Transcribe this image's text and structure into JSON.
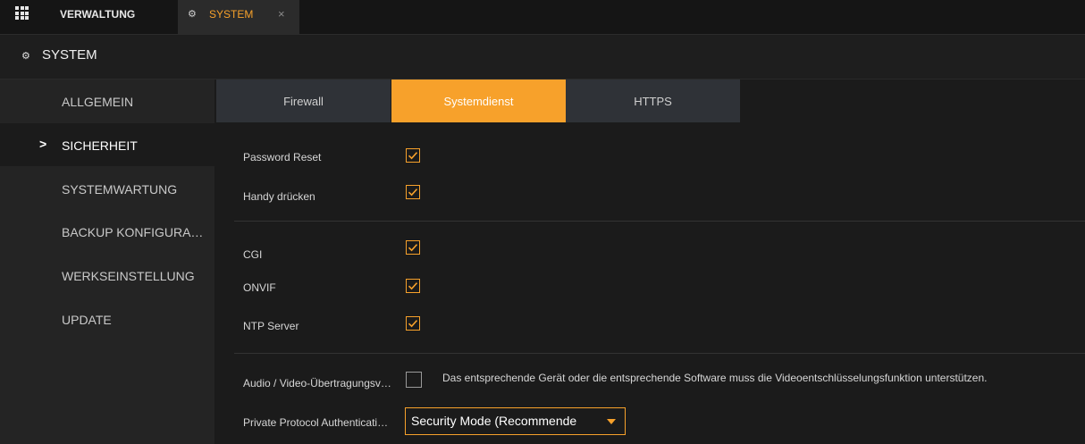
{
  "topbar": {
    "apps_icon": "grid-icon",
    "tab_main": "VERWALTUNG",
    "tab_system": "SYSTEM",
    "close_glyph": "×"
  },
  "header": {
    "title": "SYSTEM",
    "icon": "gear-icon"
  },
  "sidebar": {
    "items": [
      {
        "label": "ALLGEMEIN",
        "active": false
      },
      {
        "label": "SICHERHEIT",
        "active": true
      },
      {
        "label": "SYSTEMWARTUNG",
        "active": false
      },
      {
        "label": "BACKUP KONFIGURA…",
        "active": false
      },
      {
        "label": "WERKSEINSTELLUNG",
        "active": false
      },
      {
        "label": "UPDATE",
        "active": false
      }
    ]
  },
  "tabs": [
    {
      "label": "Firewall",
      "active": false
    },
    {
      "label": "Systemdienst",
      "active": true
    },
    {
      "label": "HTTPS",
      "active": false
    }
  ],
  "settings": {
    "password_reset": {
      "label": "Password Reset",
      "checked": true
    },
    "handy": {
      "label": "Handy drücken",
      "checked": true
    },
    "cgi": {
      "label": "CGI",
      "checked": true
    },
    "onvif": {
      "label": "ONVIF",
      "checked": true
    },
    "ntp": {
      "label": "NTP Server",
      "checked": true
    },
    "audio_video": {
      "label": "Audio / Video-Übertragungsv…",
      "checked": false,
      "note": "Das entsprechende Gerät oder die entsprechende Software muss die Videoentschlüsselungsfunktion unterstützen."
    },
    "private_protocol": {
      "label": "Private Protocol Authenticati…",
      "value": "Security Mode (Recommende"
    }
  },
  "colors": {
    "accent": "#f7a12b",
    "background": "#1b1b1b",
    "sidebar": "#242424"
  }
}
